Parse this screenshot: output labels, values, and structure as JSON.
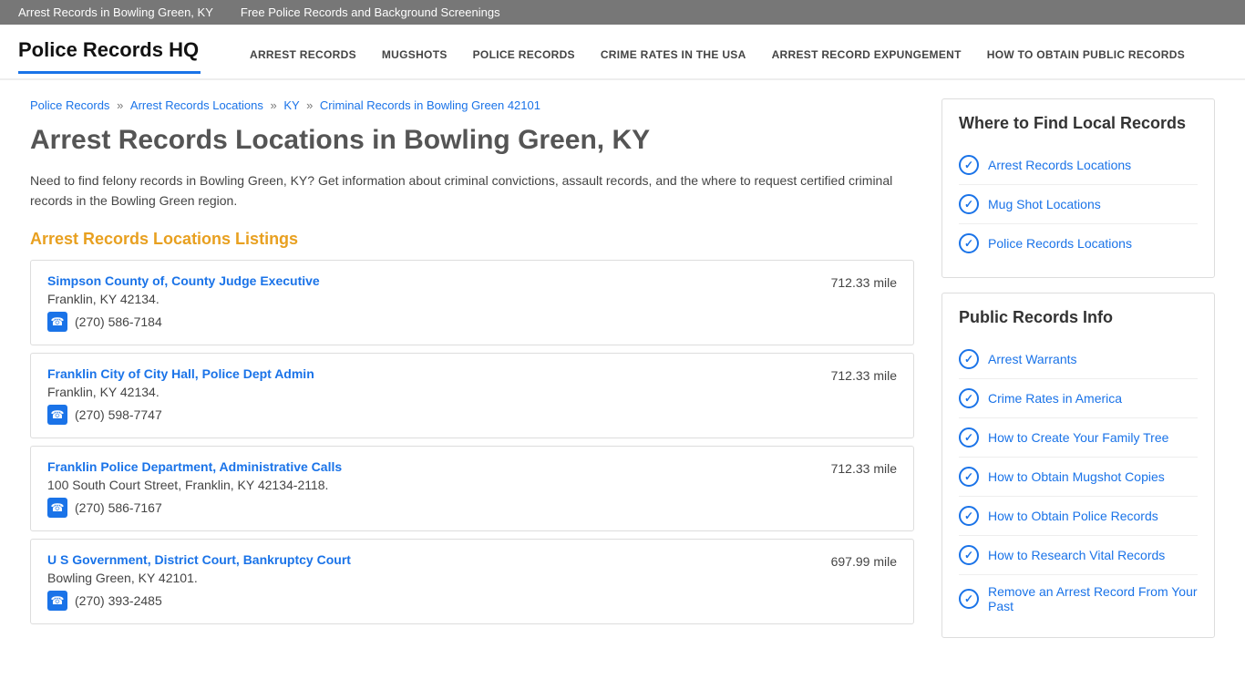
{
  "topbar": {
    "link1": "Arrest Records in Bowling Green, KY",
    "link2": "Free Police Records and Background Screenings"
  },
  "header": {
    "logo": "Police Records HQ",
    "nav": [
      {
        "label": "ARREST RECORDS",
        "href": "#"
      },
      {
        "label": "MUGSHOTS",
        "href": "#"
      },
      {
        "label": "POLICE RECORDS",
        "href": "#"
      },
      {
        "label": "CRIME RATES IN THE USA",
        "href": "#"
      },
      {
        "label": "ARREST RECORD EXPUNGEMENT",
        "href": "#"
      },
      {
        "label": "HOW TO OBTAIN PUBLIC RECORDS",
        "href": "#"
      }
    ]
  },
  "breadcrumb": {
    "items": [
      {
        "label": "Police Records",
        "href": "#"
      },
      {
        "label": "Arrest Records Locations",
        "href": "#"
      },
      {
        "label": "KY",
        "href": "#"
      },
      {
        "label": "Criminal Records in Bowling Green 42101",
        "href": "#"
      }
    ]
  },
  "page": {
    "title": "Arrest Records Locations in Bowling Green, KY",
    "intro": "Need to find felony records in Bowling Green, KY? Get information about criminal convictions, assault records, and the where to request certified criminal records in the Bowling Green region.",
    "listings_heading": "Arrest Records Locations Listings"
  },
  "listings": [
    {
      "name": "Simpson County of, County Judge Executive",
      "address": "Franklin, KY 42134.",
      "phone": "(270) 586-7184",
      "distance": "712.33 mile"
    },
    {
      "name": "Franklin City of City Hall, Police Dept Admin",
      "address": "Franklin, KY 42134.",
      "phone": "(270) 598-7747",
      "distance": "712.33 mile"
    },
    {
      "name": "Franklin Police Department, Administrative Calls",
      "address": "100 South Court Street, Franklin, KY 42134-2118.",
      "phone": "(270) 586-7167",
      "distance": "712.33 mile"
    },
    {
      "name": "U S Government, District Court, Bankruptcy Court",
      "address": "Bowling Green, KY 42101.",
      "phone": "(270) 393-2485",
      "distance": "697.99 mile"
    }
  ],
  "sidebar": {
    "local_records": {
      "title": "Where to Find Local Records",
      "links": [
        "Arrest Records Locations",
        "Mug Shot Locations",
        "Police Records Locations"
      ]
    },
    "public_records": {
      "title": "Public Records Info",
      "links": [
        "Arrest Warrants",
        "Crime Rates in America",
        "How to Create Your Family Tree",
        "How to Obtain Mugshot Copies",
        "How to Obtain Police Records",
        "How to Research Vital Records",
        "Remove an Arrest Record From Your Past"
      ]
    }
  }
}
